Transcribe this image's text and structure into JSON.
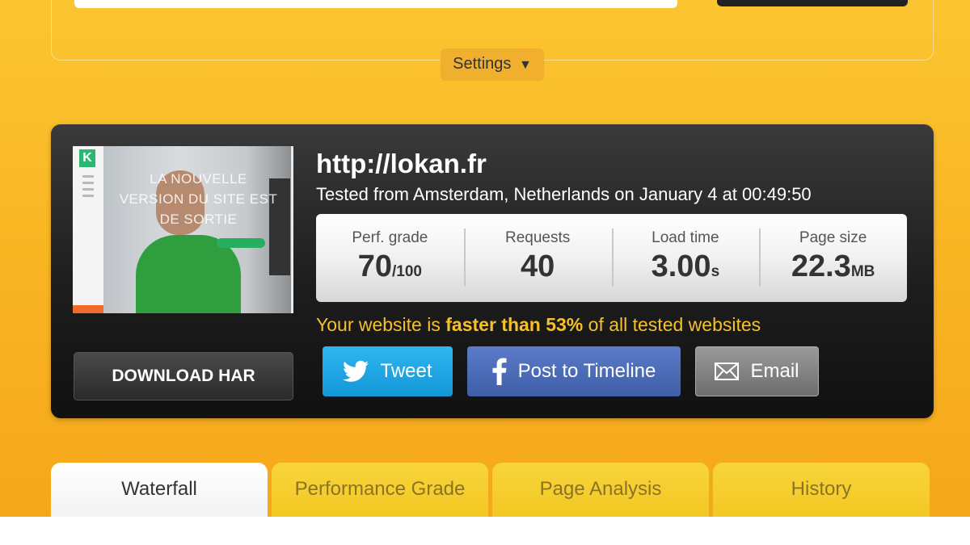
{
  "settings": {
    "label": "Settings",
    "caret": "▼"
  },
  "result": {
    "url": "http://lokan.fr",
    "tested_from": "Tested from Amsterdam, Netherlands on January 4 at 00:49:50",
    "thumbnail": {
      "logo": "K",
      "headline_lines": [
        "LA NOUVELLE",
        "VERSION DU SITE EST",
        "DE SORTIE"
      ]
    },
    "stats": [
      {
        "label": "Perf. grade",
        "value": "70",
        "unit": "/100"
      },
      {
        "label": "Requests",
        "value": "40",
        "unit": ""
      },
      {
        "label": "Load time",
        "value": "3.00",
        "unit": "s"
      },
      {
        "label": "Page size",
        "value": "22.3",
        "unit": "MB"
      }
    ],
    "comparison": {
      "prefix": "Your website is ",
      "highlight": "faster than 53%",
      "suffix": " of all tested websites"
    },
    "download_har": "DOWNLOAD HAR",
    "share": {
      "tweet": "Tweet",
      "facebook": "Post to Timeline",
      "email": "Email"
    }
  },
  "tabs": [
    {
      "label": "Waterfall",
      "active": true
    },
    {
      "label": "Performance Grade",
      "active": false
    },
    {
      "label": "Page Analysis",
      "active": false
    },
    {
      "label": "History",
      "active": false
    }
  ],
  "colors": {
    "background": "#f9b623",
    "highlight_text": "#f6c02b",
    "twitter": "#1da1f2",
    "facebook": "#3e5ea8"
  }
}
